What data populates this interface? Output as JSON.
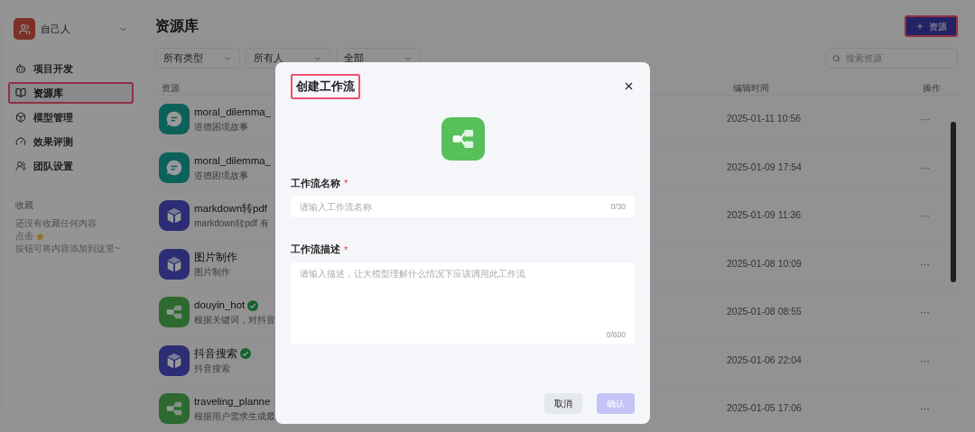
{
  "sidebar": {
    "team": "自己人",
    "nav": [
      {
        "label": "项目开发",
        "selected": false
      },
      {
        "label": "资源库",
        "selected": true
      },
      {
        "label": "模型管理",
        "selected": false
      },
      {
        "label": "效果评测",
        "selected": false
      },
      {
        "label": "团队设置",
        "selected": false
      }
    ],
    "favorites": {
      "title": "收藏",
      "empty_line1": "还没有收藏任何内容",
      "empty_line2_before": "点击",
      "empty_line2_after": "按钮可将内容添加到这里~"
    }
  },
  "page": {
    "title": "资源库",
    "add_button": "资源",
    "filters": [
      "所有类型",
      "所有人",
      "全部"
    ],
    "search": {
      "placeholder": "搜索资源"
    },
    "columns": {
      "resource": "资源",
      "edited": "编辑时间",
      "actions": "操作"
    },
    "rows": [
      {
        "kind": "chat",
        "name": "moral_dilemma_",
        "desc": "道德困境故事",
        "verified": false,
        "edited": "2025-01-11 10:56",
        "action": "···"
      },
      {
        "kind": "chat",
        "name": "moral_dilemma_",
        "desc": "道德困境故事",
        "verified": false,
        "edited": "2025-01-09 17:54",
        "action": "···"
      },
      {
        "kind": "plugin",
        "name": "markdown转pdf",
        "desc": "markdown转pdf 有",
        "verified": false,
        "edited": "2025-01-09 11:36",
        "action": "···"
      },
      {
        "kind": "plugin",
        "name": "图片制作",
        "desc": "图片制作",
        "verified": false,
        "edited": "2025-01-08 10:09",
        "action": "···"
      },
      {
        "kind": "workflow",
        "name": "douyin_hot",
        "desc": "根据关键词，对抖音",
        "verified": true,
        "edited": "2025-01-08 08:55",
        "action": "···"
      },
      {
        "kind": "plugin",
        "name": "抖音搜索",
        "desc": "抖音搜索",
        "verified": true,
        "edited": "2025-01-06 22:04",
        "action": "···"
      },
      {
        "kind": "workflow",
        "name": "traveling_planne",
        "desc": "根据用户需求生成最",
        "verified": false,
        "edited": "2025-01-05 17:06",
        "action": "···"
      }
    ]
  },
  "dialog": {
    "title": "创建工作流",
    "fields": [
      {
        "kind": "input",
        "label": "工作流名称",
        "required_mark": "*",
        "placeholder": "请输入工作流名称",
        "count": "0/30"
      },
      {
        "kind": "textarea",
        "label": "工作流描述",
        "required_mark": "*",
        "placeholder": "请输入描述，让大模型理解什么情况下应该调用此工作流",
        "count": "0/600"
      }
    ],
    "cancel": "取消",
    "confirm": {
      "label": "确认",
      "disabled": true
    }
  }
}
